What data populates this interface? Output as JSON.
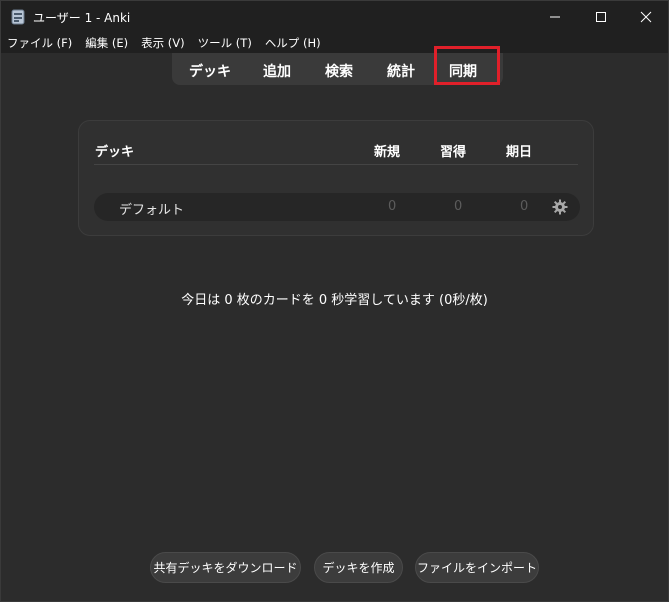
{
  "window": {
    "title": "ユーザー 1 - Anki",
    "minimize_icon": "minimize-icon",
    "maximize_icon": "maximize-icon",
    "close_icon": "close-icon"
  },
  "menu": [
    {
      "label": "ファイル (F)"
    },
    {
      "label": "編集 (E)"
    },
    {
      "label": "表示 (V)"
    },
    {
      "label": "ツール (T)"
    },
    {
      "label": "ヘルプ (H)"
    }
  ],
  "toolbar": {
    "items": [
      {
        "label": "デッキ"
      },
      {
        "label": "追加"
      },
      {
        "label": "検索"
      },
      {
        "label": "統計"
      },
      {
        "label": "同期"
      }
    ],
    "highlighted": "同期",
    "highlight_color": "#e0202a"
  },
  "deck_table": {
    "headers": {
      "deck": "デッキ",
      "new": "新規",
      "learn": "習得",
      "due": "期日"
    },
    "rows": [
      {
        "name": "デフォルト",
        "new": "0",
        "learn": "0",
        "due": "0",
        "options_icon": "gear-icon"
      }
    ]
  },
  "study_stats": "今日は 0 枚のカードを 0 秒学習しています (0秒/枚)",
  "bottom_buttons": [
    {
      "label": "共有デッキをダウンロード"
    },
    {
      "label": "デッキを作成"
    },
    {
      "label": "ファイルをインポート"
    }
  ],
  "colors": {
    "background": "#2c2c2c",
    "titlebar": "#202020",
    "panel": "#303030",
    "row": "#262626",
    "muted_count": "#5c5c5c"
  }
}
